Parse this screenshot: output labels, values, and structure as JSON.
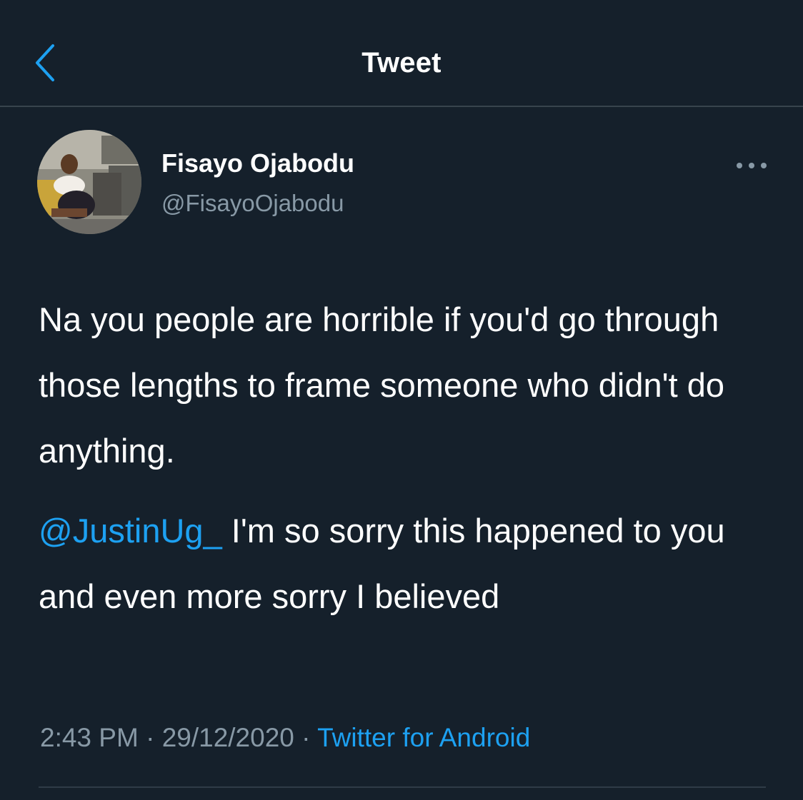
{
  "header": {
    "title": "Tweet",
    "back_icon": "chevron-left-icon",
    "accent_color": "#1da1f2"
  },
  "author": {
    "display_name": "Fisayo Ojabodu",
    "handle": "@FisayoOjabodu",
    "avatar_icon": "profile-photo"
  },
  "more_icon": "more-dots-icon",
  "tweet": {
    "paragraph1": "Na you people are horrible if you'd go through those lengths to frame someone who didn't do anything.",
    "mention": "@JustinUg_",
    "paragraph2_rest": " I'm so sorry this happened to you and even more sorry I believed"
  },
  "meta": {
    "time": "2:43 PM",
    "separator": " · ",
    "date": "29/12/2020",
    "source": "Twitter for Android"
  },
  "colors": {
    "background": "#15202b",
    "text": "#ffffff",
    "secondary": "#8899a6",
    "link": "#1da1f2",
    "divider": "#38444d"
  }
}
